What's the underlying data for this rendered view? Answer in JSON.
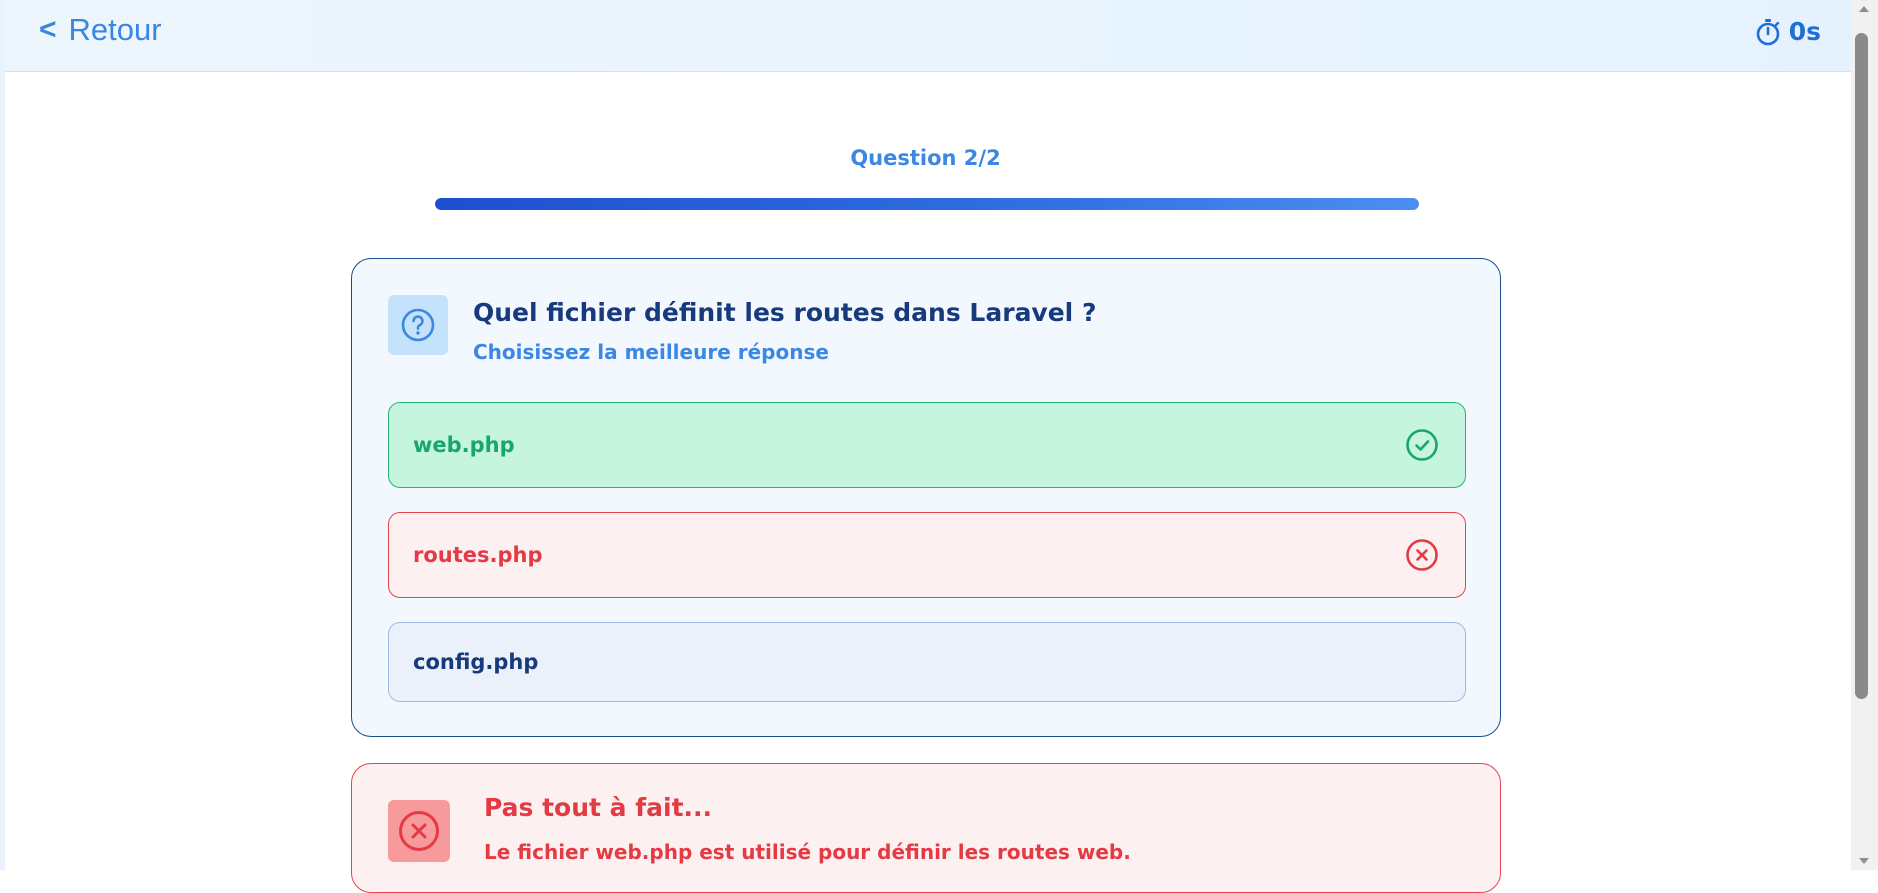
{
  "header": {
    "back_label": "Retour",
    "back_chevron": "<",
    "back_icon": "chevron-left-icon",
    "timer_icon": "stopwatch-icon",
    "timer_value": "0s"
  },
  "progress": {
    "label": "Question 2/2",
    "current": 2,
    "total": 2,
    "fraction": 1.0
  },
  "question": {
    "icon": "question-circle-icon",
    "title": "Quel fichier définit les routes dans Laravel ?",
    "subtitle": "Choisissez la meilleure réponse",
    "answers": [
      {
        "label": "web.php",
        "state": "correct",
        "icon": "check-circle-icon"
      },
      {
        "label": "routes.php",
        "state": "selected-wrong",
        "icon": "x-circle-icon"
      },
      {
        "label": "config.php",
        "state": "neutral"
      }
    ]
  },
  "feedback": {
    "icon": "x-circle-icon",
    "title": "Pas tout à fait...",
    "text": "Le fichier web.php est utilisé pour définir les routes web."
  },
  "colors": {
    "accent": "#3b87e3",
    "correct": "#19a56c",
    "wrong": "#e33a44",
    "dark_text": "#173a7d"
  }
}
